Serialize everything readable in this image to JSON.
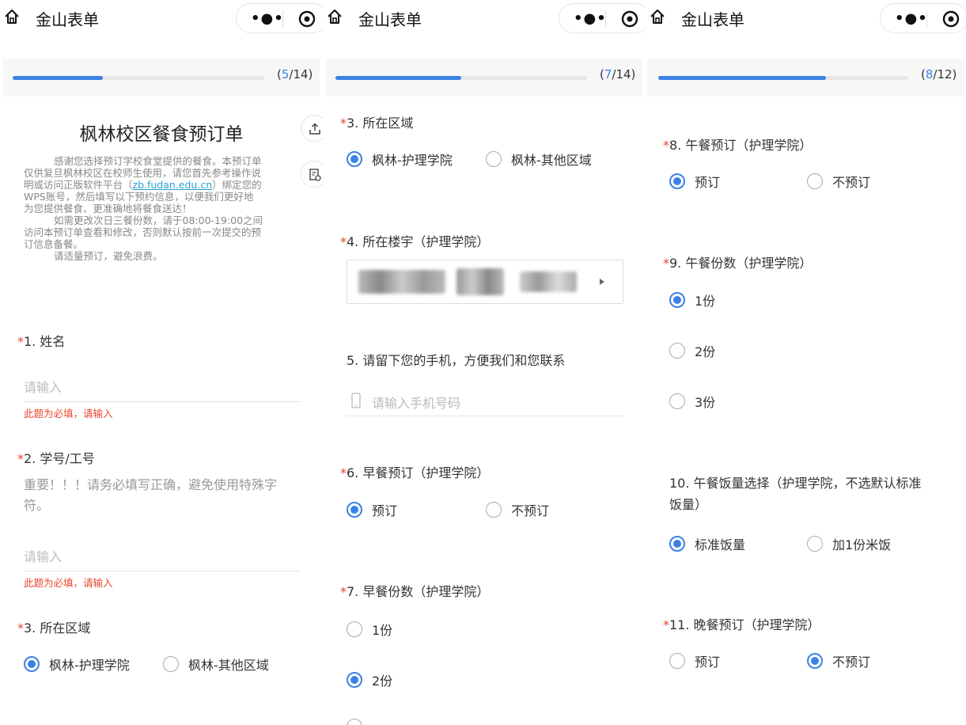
{
  "accent_color": "#3c82e6",
  "required_color": "#e8452e",
  "topbar": {
    "title": "金山表单",
    "more_icon": "more-dots-icon",
    "target_icon": "target-icon",
    "home_icon": "home-icon"
  },
  "panel1": {
    "progress": {
      "current": "5",
      "total": "/14",
      "open": "(",
      "close": ")",
      "fraction": 0.357
    },
    "form_title": "枫林校区餐食预订单",
    "description": [
      "感谢您选择预订学校食堂提供的餐食。本预订单",
      "仅供复旦枫林校区在校师生使用，请您首先参考操作说",
      "明或访问正版软件平台（",
      "zb.fudan.edu.cn",
      "）绑定您的",
      "WPS账号，然后填写以下预约信息，以便我们更好地",
      "为您提供餐食、更准确地将餐食送达！",
      "如需更改次日三餐份数，请于08:00-19:00之间",
      "访问本预订单查看和修改，否则默认按前一次提交的预",
      "订信息备餐。",
      "请适量预订，避免浪费。"
    ],
    "q1": {
      "star": "*",
      "label": "1.  姓名",
      "placeholder": "请输入",
      "error": "此题为必填，请输入"
    },
    "q2": {
      "star": "*",
      "label": "2.  学号/工号",
      "hint": "重要！！！请务必填写正确，避免使用特殊字符。",
      "placeholder": "请输入",
      "error": "此题为必填，请输入"
    },
    "q3": {
      "star": "*",
      "label": "3.  所在区域",
      "options": [
        "枫林-护理学院",
        "枫林-其他区域"
      ]
    }
  },
  "panel2": {
    "progress": {
      "current": "7",
      "total": "/14",
      "open": "(",
      "close": ")",
      "fraction": 0.5
    },
    "q3": {
      "star": "*",
      "label": "3.  所在区域",
      "options": [
        "枫林-护理学院",
        "枫林-其他区域"
      ]
    },
    "q4": {
      "star": "*",
      "label": "4.  所在楼宇（护理学院）"
    },
    "q5": {
      "label": "5.  请留下您的手机，方便我们和您联系",
      "placeholder": "请输入手机号码"
    },
    "q6": {
      "star": "*",
      "label": "6.  早餐预订（护理学院）",
      "options": [
        "预订",
        "不预订"
      ]
    },
    "q7": {
      "star": "*",
      "label": "7.  早餐份数（护理学院）",
      "options": [
        "1份",
        "2份"
      ]
    }
  },
  "panel3": {
    "progress": {
      "current": "8",
      "total": "/12",
      "open": "(",
      "close": ")",
      "fraction": 0.67
    },
    "q8": {
      "star": "*",
      "label": "8.  午餐预订（护理学院）",
      "options": [
        "预订",
        "不预订"
      ]
    },
    "q9": {
      "star": "*",
      "label": "9.  午餐份数（护理学院）",
      "options": [
        "1份",
        "2份",
        "3份"
      ]
    },
    "q10": {
      "label_line1": "10.  午餐饭量选择（护理学院，不选默认标准",
      "label_line2": "饭量）",
      "options": [
        "标准饭量",
        "加1份米饭"
      ]
    },
    "q11": {
      "star": "*",
      "label": "11.  晚餐预订（护理学院）",
      "options": [
        "预订",
        "不预订"
      ]
    }
  }
}
